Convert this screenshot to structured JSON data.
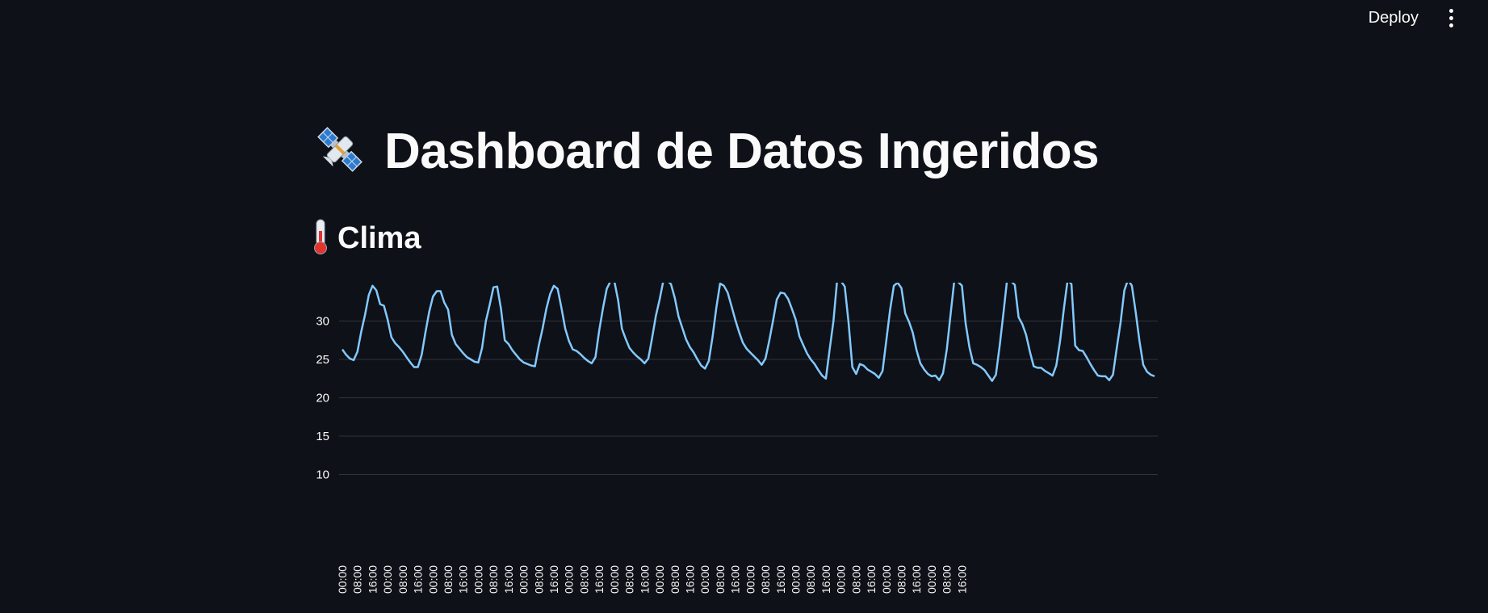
{
  "toolbar": {
    "deploy_label": "Deploy",
    "menu_icon": "kebab-menu-icon"
  },
  "page": {
    "title": "Dashboard de Datos Ingeridos",
    "title_icon": "satellite-icon"
  },
  "section": {
    "title": "Clima",
    "icon": "thermometer-icon"
  },
  "colors": {
    "background": "#0e1117",
    "text": "#fafafa",
    "line": "#83c9ff",
    "grid": "#31333f"
  },
  "chart_data": {
    "type": "line",
    "title": "",
    "xlabel": "",
    "ylabel": "",
    "ylim": [
      5,
      35
    ],
    "y_ticks": [
      10,
      15,
      20,
      25,
      30
    ],
    "x_tick_labels": [
      "00:00",
      "08:00",
      "16:00",
      "00:00",
      "08:00",
      "16:00",
      "00:00",
      "08:00",
      "16:00",
      "00:00",
      "08:00",
      "16:00",
      "00:00",
      "08:00",
      "16:00",
      "00:00",
      "08:00",
      "16:00",
      "00:00",
      "08:00",
      "16:00",
      "00:00",
      "08:00",
      "16:00",
      "00:00",
      "08:00",
      "16:00",
      "00:00",
      "08:00",
      "16:00",
      "00:00",
      "08:00",
      "16:00",
      "00:00",
      "08:00",
      "16:00",
      "00:00",
      "08:00",
      "16:00",
      "00:00",
      "08:00",
      "16:00"
    ],
    "grid": true,
    "x_interval_hours": 2,
    "series": [
      {
        "values": [
          26.3,
          25.6,
          25.1,
          24.9,
          26.0,
          28.6,
          30.8,
          33.4,
          34.6,
          34.0,
          32.2,
          32.0,
          30.2,
          27.9,
          27.1,
          26.6,
          26.0,
          25.3,
          24.6,
          24.0,
          24.0,
          25.6,
          28.5,
          31.2,
          33.2,
          33.9,
          33.9,
          32.4,
          31.5,
          28.2,
          27.0,
          26.4,
          25.8,
          25.3,
          25.0,
          24.7,
          24.6,
          26.5,
          30.0,
          32.1,
          34.4,
          34.5,
          31.6,
          27.5,
          27.0,
          26.2,
          25.6,
          25.0,
          24.6,
          24.4,
          24.2,
          24.1,
          26.8,
          29.0,
          31.6,
          33.5,
          34.6,
          34.2,
          31.7,
          29.0,
          27.4,
          26.3,
          26.1,
          25.7,
          25.2,
          24.8,
          24.5,
          25.3,
          28.8,
          31.7,
          34.2,
          35.2,
          35.2,
          32.7,
          29.0,
          27.7,
          26.5,
          25.9,
          25.4,
          25.0,
          24.5,
          25.1,
          27.8,
          30.7,
          32.8,
          35.3,
          35.3,
          34.8,
          33.0,
          30.6,
          29.1,
          27.6,
          26.6,
          25.9,
          25.0,
          24.2,
          23.8,
          24.8,
          27.9,
          31.7,
          34.9,
          34.6,
          33.7,
          32.0,
          30.2,
          28.6,
          27.2,
          26.4,
          25.9,
          25.4,
          24.9,
          24.3,
          25.1,
          27.4,
          30.0,
          32.8,
          33.7,
          33.6,
          32.9,
          31.6,
          30.2,
          28.0,
          26.9,
          25.8,
          25.0,
          24.4,
          23.6,
          22.9,
          22.5,
          26.3,
          30.0,
          35.5,
          35.2,
          34.5,
          29.8,
          24.0,
          23.1,
          24.4,
          24.2,
          23.7,
          23.4,
          23.1,
          22.6,
          23.5,
          27.5,
          31.5,
          34.6,
          35.0,
          34.3,
          31.0,
          29.9,
          28.5,
          26.2,
          24.5,
          23.7,
          23.1,
          22.8,
          22.9,
          22.3,
          23.2,
          26.3,
          30.8,
          35.3,
          35.1,
          34.6,
          29.7,
          26.6,
          24.5,
          24.3,
          24.0,
          23.6,
          22.9,
          22.2,
          23.0,
          26.8,
          31.0,
          35.5,
          35.2,
          34.7,
          30.5,
          29.6,
          28.2,
          26.0,
          24.1,
          23.9,
          23.9,
          23.5,
          23.2,
          22.9,
          24.2,
          27.4,
          31.6,
          35.4,
          34.8,
          26.8,
          26.2,
          26.1,
          25.3,
          24.4,
          23.6,
          22.9,
          22.8,
          22.8,
          22.3,
          23.0,
          26.5,
          29.8,
          34.0,
          35.4,
          34.6,
          31.2,
          27.4,
          24.3,
          23.4,
          23.0,
          22.8
        ]
      }
    ]
  }
}
